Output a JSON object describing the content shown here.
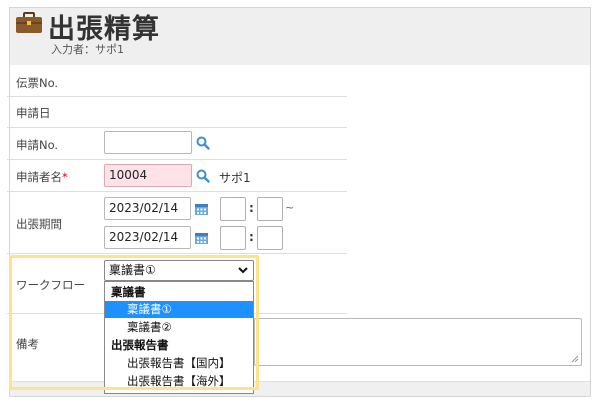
{
  "header": {
    "title": "出張精算",
    "subtitle": "入力者：サポ1",
    "icon": "briefcase-icon"
  },
  "form": {
    "slip_no": {
      "label": "伝票No."
    },
    "apply_date": {
      "label": "申請日"
    },
    "apply_no": {
      "label": "申請No.",
      "value": "",
      "icon": "search-icon"
    },
    "applicant": {
      "label": "申請者名",
      "required_mark": "*",
      "value": "10004",
      "name": "サポ1",
      "icon": "search-icon"
    },
    "period": {
      "label": "出張期間",
      "start_date": "2023/02/14",
      "end_date": "2023/02/14",
      "colon": ":",
      "range_mark": "~",
      "icon": "calendar-icon"
    },
    "workflow": {
      "label": "ワークフロー",
      "selected": "稟議書①",
      "options": [
        {
          "label": "稟議書",
          "type": "group"
        },
        {
          "label": "稟議書①",
          "type": "item",
          "selected": true
        },
        {
          "label": "稟議書②",
          "type": "item"
        },
        {
          "label": "出張報告書",
          "type": "group"
        },
        {
          "label": "出張報告書【国内】",
          "type": "item"
        },
        {
          "label": "出張報告書【海外】",
          "type": "item"
        }
      ]
    },
    "remarks": {
      "label": "備考",
      "value": ""
    }
  },
  "colors": {
    "header_bg": "#efefef",
    "required_field_bg": "#fde2e7",
    "highlight_border": "#ffe38a",
    "selected_option_bg": "#1e90ff",
    "icon_blue": "#3d8fd1"
  }
}
